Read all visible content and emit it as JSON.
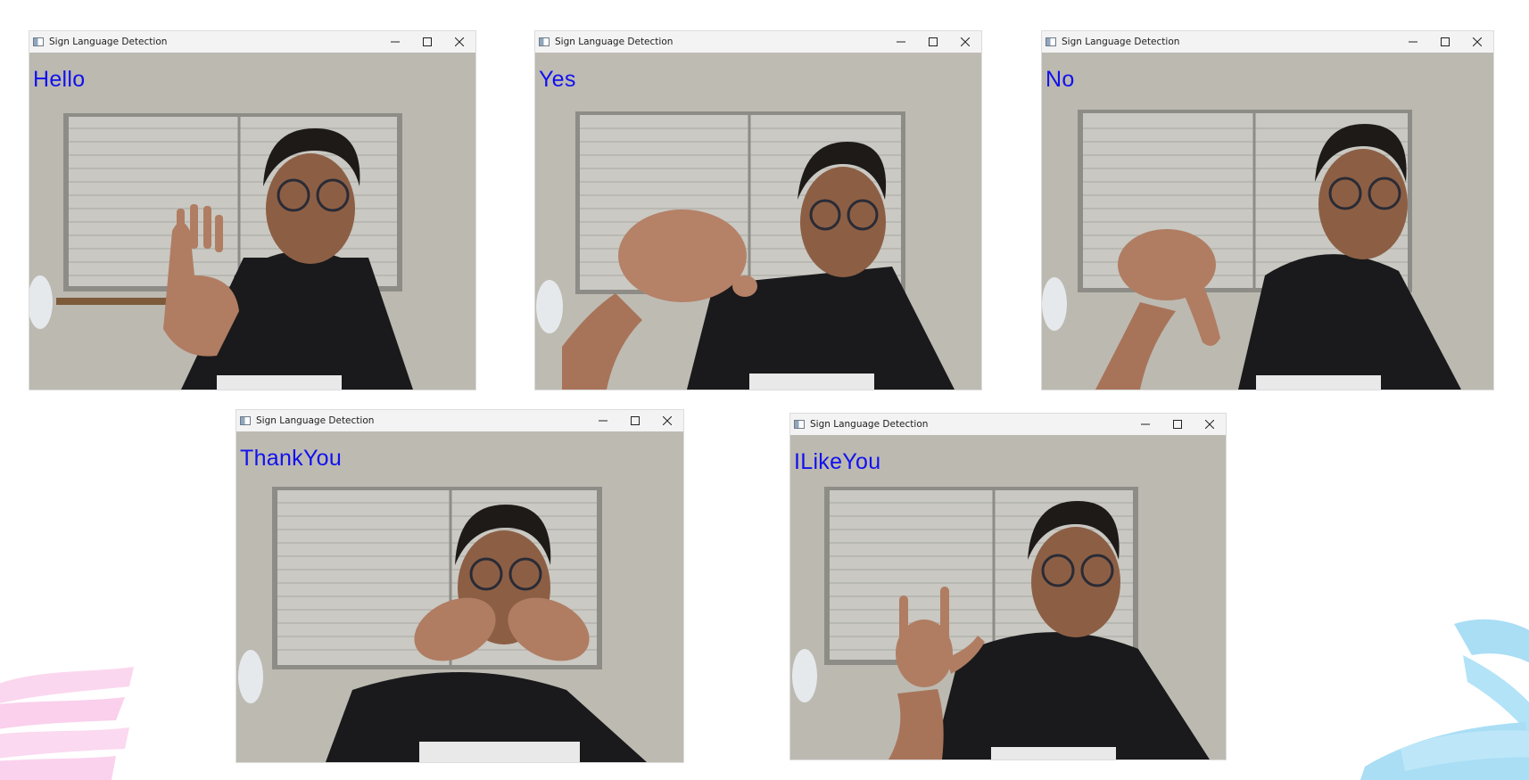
{
  "windows": [
    {
      "title": "Sign Language Detection",
      "prediction": "Hello",
      "gesture": "open-palm"
    },
    {
      "title": "Sign Language Detection",
      "prediction": "Yes",
      "gesture": "fist"
    },
    {
      "title": "Sign Language Detection",
      "prediction": "No",
      "gesture": "pinch"
    },
    {
      "title": "Sign Language Detection",
      "prediction": "ThankYou",
      "gesture": "both-hands-mouth"
    },
    {
      "title": "Sign Language Detection",
      "prediction": "ILikeYou",
      "gesture": "ily-sign"
    }
  ],
  "icons": {
    "window_app": "app-window-icon",
    "minimize": "minimize-icon",
    "maximize": "maximize-icon",
    "close": "close-icon"
  },
  "colors": {
    "prediction_text": "#1111ee",
    "titlebar": "#f3f3f3",
    "brush_pink": "#fbd7ef",
    "brush_blue": "#a9def5"
  }
}
